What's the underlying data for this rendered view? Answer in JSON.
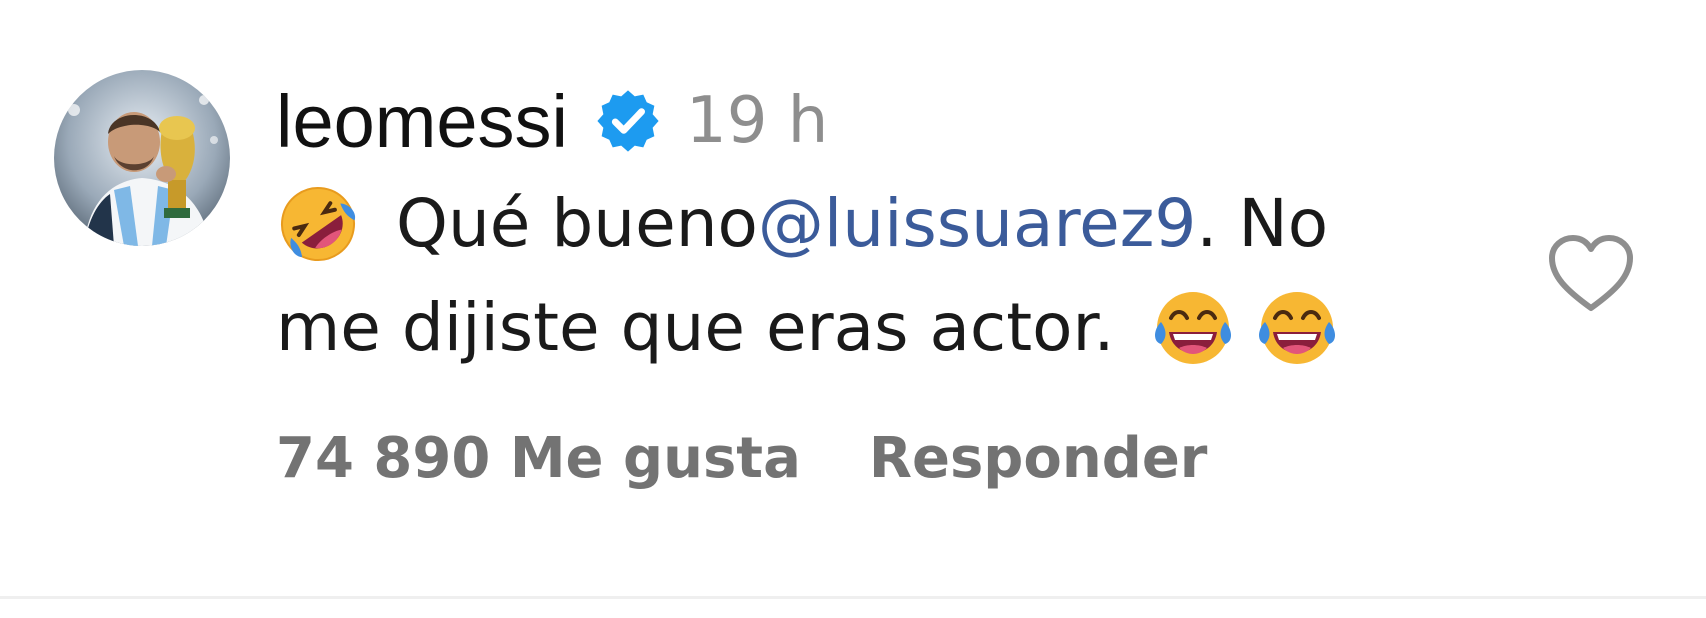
{
  "comment": {
    "username": "leomessi",
    "verified_icon": "verified-badge-icon",
    "timestamp": "19 h",
    "text_line1_prefix": "Qué bueno ",
    "mention": "@luissuarez9",
    "text_line1_suffix": ". No",
    "text_line2": "me dijiste que eras actor.",
    "emoji_start": "rolling-on-floor-laughing-emoji",
    "emoji_end": [
      "face-with-tears-of-joy-emoji",
      "face-with-tears-of-joy-emoji"
    ],
    "like_icon": "heart-outline-icon",
    "likes_label": "74 890 Me gusta",
    "reply_label": "Responder"
  },
  "colors": {
    "verified_blue": "#1d9bf0",
    "mention_blue": "#3b5b9a",
    "secondary_gray": "#737373"
  }
}
